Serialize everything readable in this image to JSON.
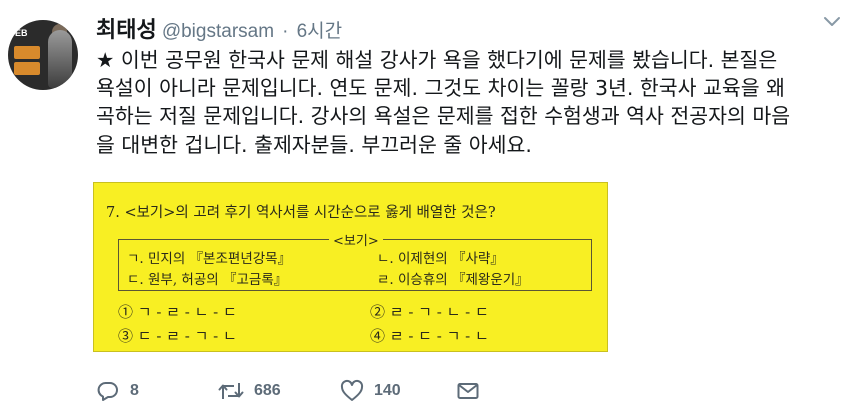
{
  "tweet": {
    "display_name": "최태성",
    "handle": "@bigstarsam",
    "separator": "·",
    "timestamp": "6시간",
    "text": "★ 이번 공무원 한국사 문제 해설 강사가 욕을 했다기에 문제를 봤습니다. 본질은\n욕설이 아니라 문제입니다. 연도 문제. 그것도 차이는 꼴랑 3년. 한국사 교육을 왜\n곡하는 저질 문제입니다. 강사의 욕설은 문제를 접한 수험생과 역사 전공자의 마음\n을 대변한 겁니다. 출제자분들. 부끄러운 줄 아세요.",
    "avatar_text": "EB"
  },
  "exam": {
    "question": "7. <보기>의 고려 후기 역사서를 시간순으로 옳게 배열한 것은?",
    "bogi_title": "<보기>",
    "items": [
      "ㄱ. 민지의 『본조편년강목』",
      "ㄴ. 이제현의 『사략』",
      "ㄷ. 원부, 허공의 『고금록』",
      "ㄹ. 이승휴의 『제왕운기』"
    ],
    "options": [
      "① ㄱ - ㄹ - ㄴ - ㄷ",
      "② ㄹ - ㄱ - ㄴ - ㄷ",
      "③ ㄷ - ㄹ - ㄱ - ㄴ",
      "④ ㄹ - ㄷ - ㄱ - ㄴ"
    ]
  },
  "actions": {
    "reply_count": "8",
    "retweet_count": "686",
    "like_count": "140"
  },
  "icons": {
    "reply": "reply-icon",
    "retweet": "retweet-icon",
    "like": "heart-icon",
    "message": "envelope-icon",
    "menu": "chevron-down-icon"
  },
  "colors": {
    "text": "#14171a",
    "secondary": "#657786",
    "icon": "#5d6b78",
    "exam_background": "#f8ef23"
  }
}
